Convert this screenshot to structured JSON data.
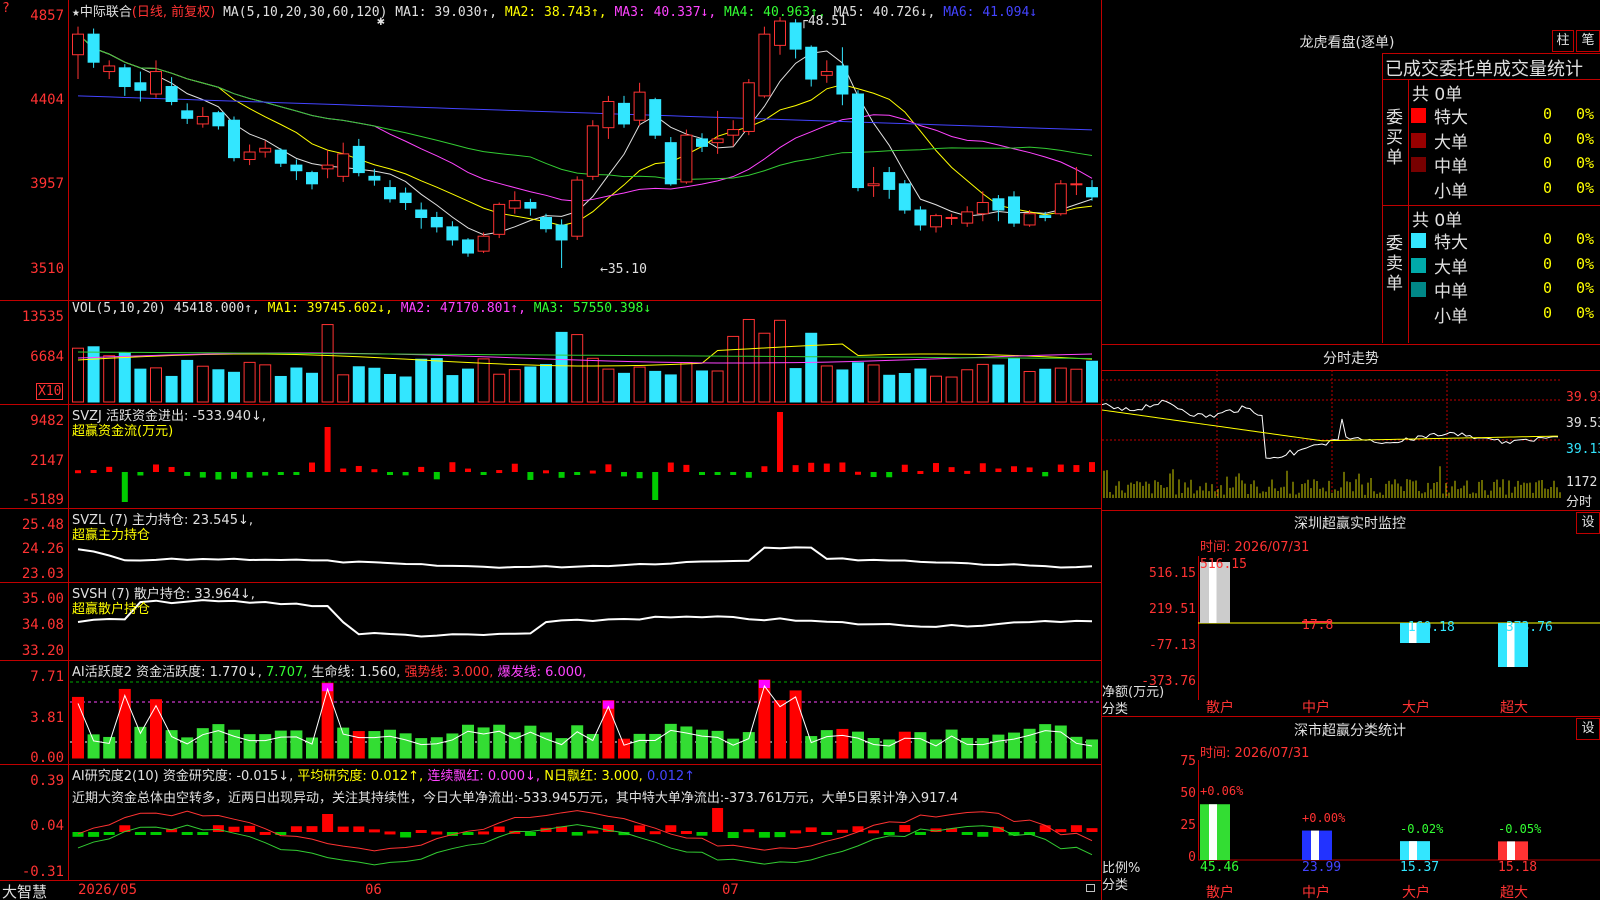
{
  "header": {
    "corner_icon": "menu-icon",
    "star": "★",
    "stock_name": "中际联合",
    "period": "(日线, 前复权)",
    "ma_label": "MA(5,10,20,30,60,120)",
    "ma1": "MA1: 39.030↑,",
    "ma2": "MA2: 38.743↑,",
    "ma3": "MA3: 40.337↓,",
    "ma4": "MA4: 40.963↑,",
    "ma5": "MA5: 40.726↓,",
    "ma6": "MA6: 41.094↓"
  },
  "price_axis": [
    "4857",
    "4404",
    "3957",
    "3510"
  ],
  "price_annotations": {
    "high": "48.51",
    "low": "←35.10",
    "star_mark": "✱"
  },
  "vol": {
    "axis": [
      "13535",
      "6684"
    ],
    "unit": "X10",
    "label": "VOL(5,10,20)",
    "value": "45418.000↑,",
    "ma1": "MA1: 39745.602↓,",
    "ma2": "MA2: 47170.801↑,",
    "ma3": "MA3: 57550.398↓"
  },
  "svzj": {
    "axis": [
      "9482",
      "2147",
      "-5189"
    ],
    "label": "SVZJ  活跃资金进出: -533.940↓,",
    "sub": "超赢资金流(万元)"
  },
  "svzl": {
    "axis": [
      "25.48",
      "24.26",
      "23.03"
    ],
    "label": "SVZL (7) 主力持仓: 23.545↓,",
    "sub": "超赢主力持仓"
  },
  "svsh": {
    "axis": [
      "35.00",
      "34.08",
      "33.20"
    ],
    "label": "SVSH (7) 散户持仓: 33.964↓,",
    "sub": "超赢散户持仓"
  },
  "ai_active": {
    "axis": [
      "7.71",
      "3.81",
      "0.00"
    ],
    "label": "AI活跃度2 资金活跃度: 1.770↓,",
    "v2": "7.707,",
    "life": "生命线: 1.560,",
    "strong": "强势线: 3.000,",
    "burst": "爆发线: 6.000,"
  },
  "ai_research": {
    "axis": [
      "0.39",
      "0.04",
      "-0.31"
    ],
    "label": "AI研究度2(10) 资金研究度: -0.015↓,",
    "avg": "平均研究度: 0.012↑,",
    "lianxu": "连续飘红: 0.000↓,",
    "nday": "N日飘红: 3.000,",
    "last": "0.012↑",
    "comment": "近期大资金总体由空转多，近两日出现异动，关注其持续性，今日大单净流出:-533.945万元，其中特大单净流出:-373.761万元，大单5日累计净入917.4"
  },
  "date_axis": {
    "brand": "大智慧",
    "d1": "2026/05",
    "d2": "06",
    "d3": "07"
  },
  "right": {
    "lhb_title": "龙虎看盘(逐单)",
    "btn_zhu": "柱",
    "btn_bi": "笔",
    "stats_title": "已成交委托单成交量统计",
    "buy": {
      "side_label": "委买单",
      "total": "共 0单",
      "rows": [
        {
          "label": "特大",
          "count": "0",
          "pct": "0%",
          "color": "#ff0000"
        },
        {
          "label": "大单",
          "count": "0",
          "pct": "0%",
          "color": "#990000"
        },
        {
          "label": "中单",
          "count": "0",
          "pct": "0%",
          "color": "#770000"
        },
        {
          "label": "小单",
          "count": "0",
          "pct": "0%",
          "color": "#000000"
        }
      ]
    },
    "sell": {
      "side_label": "委卖单",
      "total": "共 0单",
      "rows": [
        {
          "label": "特大",
          "count": "0",
          "pct": "0%",
          "color": "#33e6ff"
        },
        {
          "label": "大单",
          "count": "0",
          "pct": "0%",
          "color": "#00aaaa"
        },
        {
          "label": "中单",
          "count": "0",
          "pct": "0%",
          "color": "#008888"
        },
        {
          "label": "小单",
          "count": "0",
          "pct": "0%",
          "color": "#000000"
        }
      ]
    },
    "intraday_title": "分时走势",
    "intraday_axis": [
      "39.93",
      "39.53",
      "39.13"
    ],
    "intraday_vol": "1172",
    "intraday_unit": "分时",
    "monitor": {
      "title": "深圳超赢实时监控",
      "set": "设",
      "time": "时间: 2026/07/31",
      "axis": [
        "516.15",
        "219.51",
        "-77.13",
        "-373.76"
      ],
      "unit": "净额(万元)",
      "cat_label": "分类",
      "cats": [
        "散户",
        "中户",
        "大户",
        "超大"
      ],
      "values": [
        "516.15",
        "17.8",
        "-160.18",
        "-373.76"
      ]
    },
    "classify": {
      "title": "深市超赢分类统计",
      "set": "设",
      "time": "时间: 2026/07/31",
      "axis": [
        "75",
        "50",
        "25",
        "0"
      ],
      "unit": "比例%",
      "cat_label": "分类",
      "cats": [
        "散户",
        "中户",
        "大户",
        "超大"
      ],
      "values": [
        "45.46",
        "23.99",
        "15.37",
        "15.18"
      ],
      "changes": [
        "+0.06%",
        "+0.00%",
        "-0.02%",
        "-0.05%"
      ]
    }
  },
  "chart_data": {
    "type": "candlestick",
    "x_labels": [
      "2026/05",
      "06",
      "07"
    ],
    "y_range": [
      35.1,
      48.57
    ],
    "high": 48.51,
    "low": 35.1,
    "candles": [
      [
        46.5,
        47.6,
        45.2,
        48.0
      ],
      [
        47.6,
        46.1,
        45.8,
        47.9
      ],
      [
        45.6,
        45.9,
        45.2,
        46.2
      ],
      [
        45.8,
        44.8,
        44.3,
        46.0
      ],
      [
        45.0,
        44.6,
        44.0,
        45.6
      ],
      [
        44.4,
        45.6,
        44.2,
        46.2
      ],
      [
        44.8,
        44.0,
        43.8,
        45.3
      ],
      [
        43.5,
        43.1,
        42.8,
        43.9
      ],
      [
        42.8,
        43.2,
        42.6,
        43.7
      ],
      [
        43.4,
        42.7,
        42.5,
        43.5
      ],
      [
        43.0,
        41.0,
        40.8,
        43.2
      ],
      [
        40.9,
        41.3,
        40.6,
        41.7
      ],
      [
        41.3,
        41.5,
        41.0,
        41.9
      ],
      [
        41.4,
        40.7,
        40.5,
        41.5
      ],
      [
        40.6,
        40.3,
        39.8,
        40.9
      ],
      [
        40.2,
        39.6,
        39.3,
        40.3
      ],
      [
        40.4,
        40.6,
        39.9,
        41.4
      ],
      [
        40.0,
        41.2,
        39.7,
        41.8
      ],
      [
        41.6,
        40.2,
        40.0,
        42.0
      ],
      [
        40.0,
        39.8,
        39.5,
        40.4
      ],
      [
        39.4,
        38.8,
        38.6,
        39.8
      ],
      [
        39.1,
        38.6,
        38.2,
        39.4
      ],
      [
        38.2,
        37.8,
        37.2,
        38.6
      ],
      [
        37.8,
        37.3,
        37.0,
        38.1
      ],
      [
        37.3,
        36.6,
        36.3,
        37.6
      ],
      [
        36.6,
        35.9,
        35.7,
        36.7
      ],
      [
        36.0,
        36.8,
        35.9,
        37.0
      ],
      [
        36.9,
        38.5,
        36.7,
        38.6
      ],
      [
        38.3,
        38.7,
        38.0,
        39.2
      ],
      [
        38.6,
        38.3,
        37.9,
        38.8
      ],
      [
        37.8,
        37.2,
        37.0,
        38.0
      ],
      [
        37.4,
        36.6,
        35.1,
        37.7
      ],
      [
        36.8,
        39.8,
        36.6,
        40.0
      ],
      [
        40.0,
        42.7,
        39.8,
        43.0
      ],
      [
        42.6,
        44.0,
        42.0,
        44.3
      ],
      [
        43.9,
        42.8,
        42.6,
        44.3
      ],
      [
        43.0,
        44.5,
        42.7,
        45.0
      ],
      [
        44.1,
        42.2,
        42.0,
        44.2
      ],
      [
        41.8,
        39.6,
        39.5,
        42.1
      ],
      [
        39.7,
        42.2,
        39.6,
        42.5
      ],
      [
        42.0,
        41.6,
        41.3,
        42.3
      ],
      [
        41.8,
        42.0,
        41.2,
        43.5
      ],
      [
        42.2,
        42.5,
        41.6,
        43.0
      ],
      [
        42.4,
        45.0,
        42.2,
        45.2
      ],
      [
        44.3,
        47.6,
        44.2,
        48.0
      ],
      [
        47.0,
        48.3,
        46.5,
        48.51
      ],
      [
        48.2,
        46.8,
        46.3,
        48.4
      ],
      [
        46.9,
        45.2,
        44.8,
        47.0
      ],
      [
        45.4,
        45.6,
        45.0,
        46.2
      ],
      [
        45.9,
        44.4,
        43.8,
        46.9
      ],
      [
        44.4,
        39.4,
        39.2,
        44.6
      ],
      [
        39.5,
        39.6,
        38.9,
        40.5
      ],
      [
        40.2,
        39.3,
        38.8,
        40.5
      ],
      [
        39.6,
        38.2,
        38.0,
        39.8
      ],
      [
        38.2,
        37.4,
        37.1,
        38.4
      ],
      [
        37.3,
        37.9,
        37.0,
        38.0
      ],
      [
        37.8,
        37.8,
        37.4,
        38.0
      ],
      [
        37.5,
        38.1,
        37.3,
        38.4
      ],
      [
        38.0,
        38.6,
        37.6,
        39.2
      ],
      [
        38.8,
        38.2,
        37.6,
        39.0
      ],
      [
        38.9,
        37.5,
        37.3,
        39.2
      ],
      [
        37.4,
        38.0,
        37.3,
        38.2
      ],
      [
        37.9,
        37.8,
        37.6,
        38.1
      ],
      [
        38.0,
        39.6,
        37.9,
        39.8
      ],
      [
        39.6,
        39.6,
        39.0,
        40.5
      ],
      [
        39.4,
        38.9,
        38.7,
        39.8
      ]
    ]
  }
}
